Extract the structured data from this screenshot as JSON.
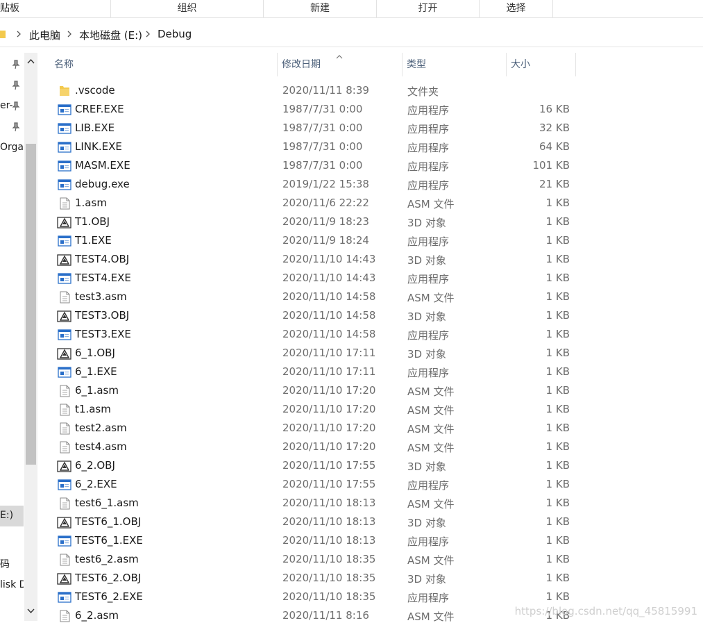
{
  "ribbon": {
    "groups": [
      "贴板",
      "组织",
      "新建",
      "打开",
      "选择"
    ]
  },
  "address": {
    "crumbs": [
      "此电脑",
      "本地磁盘 (E:)",
      "Debug"
    ]
  },
  "nav": {
    "items": [
      "",
      "",
      "er-",
      "",
      "Orga",
      "E:)",
      "",
      "码",
      "lisk D"
    ]
  },
  "columns": {
    "name": "名称",
    "date": "修改日期",
    "type": "类型",
    "size": "大小"
  },
  "files": [
    {
      "name": ".vscode",
      "date": "2020/11/11 8:39",
      "type": "文件夹",
      "size": "",
      "icon": "folder-icon"
    },
    {
      "name": "CREF.EXE",
      "date": "1987/7/31 0:00",
      "type": "应用程序",
      "size": "16 KB",
      "icon": "exe-icon"
    },
    {
      "name": "LIB.EXE",
      "date": "1987/7/31 0:00",
      "type": "应用程序",
      "size": "32 KB",
      "icon": "exe-icon"
    },
    {
      "name": "LINK.EXE",
      "date": "1987/7/31 0:00",
      "type": "应用程序",
      "size": "64 KB",
      "icon": "exe-icon"
    },
    {
      "name": "MASM.EXE",
      "date": "1987/7/31 0:00",
      "type": "应用程序",
      "size": "101 KB",
      "icon": "exe-icon"
    },
    {
      "name": "debug.exe",
      "date": "2019/1/22 15:38",
      "type": "应用程序",
      "size": "21 KB",
      "icon": "exe-icon"
    },
    {
      "name": "1.asm",
      "date": "2020/11/6 22:22",
      "type": "ASM 文件",
      "size": "1 KB",
      "icon": "text-file-icon"
    },
    {
      "name": "T1.OBJ",
      "date": "2020/11/9 18:23",
      "type": "3D 对象",
      "size": "1 KB",
      "icon": "obj-icon"
    },
    {
      "name": "T1.EXE",
      "date": "2020/11/9 18:24",
      "type": "应用程序",
      "size": "1 KB",
      "icon": "exe-icon"
    },
    {
      "name": "TEST4.OBJ",
      "date": "2020/11/10 14:43",
      "type": "3D 对象",
      "size": "1 KB",
      "icon": "obj-icon"
    },
    {
      "name": "TEST4.EXE",
      "date": "2020/11/10 14:43",
      "type": "应用程序",
      "size": "1 KB",
      "icon": "exe-icon"
    },
    {
      "name": "test3.asm",
      "date": "2020/11/10 14:58",
      "type": "ASM 文件",
      "size": "1 KB",
      "icon": "text-file-icon"
    },
    {
      "name": "TEST3.OBJ",
      "date": "2020/11/10 14:58",
      "type": "3D 对象",
      "size": "1 KB",
      "icon": "obj-icon"
    },
    {
      "name": "TEST3.EXE",
      "date": "2020/11/10 14:58",
      "type": "应用程序",
      "size": "1 KB",
      "icon": "exe-icon"
    },
    {
      "name": "6_1.OBJ",
      "date": "2020/11/10 17:11",
      "type": "3D 对象",
      "size": "1 KB",
      "icon": "obj-icon"
    },
    {
      "name": "6_1.EXE",
      "date": "2020/11/10 17:11",
      "type": "应用程序",
      "size": "1 KB",
      "icon": "exe-icon"
    },
    {
      "name": "6_1.asm",
      "date": "2020/11/10 17:20",
      "type": "ASM 文件",
      "size": "1 KB",
      "icon": "text-file-icon"
    },
    {
      "name": "t1.asm",
      "date": "2020/11/10 17:20",
      "type": "ASM 文件",
      "size": "1 KB",
      "icon": "text-file-icon"
    },
    {
      "name": "test2.asm",
      "date": "2020/11/10 17:20",
      "type": "ASM 文件",
      "size": "1 KB",
      "icon": "text-file-icon"
    },
    {
      "name": "test4.asm",
      "date": "2020/11/10 17:20",
      "type": "ASM 文件",
      "size": "1 KB",
      "icon": "text-file-icon"
    },
    {
      "name": "6_2.OBJ",
      "date": "2020/11/10 17:55",
      "type": "3D 对象",
      "size": "1 KB",
      "icon": "obj-icon"
    },
    {
      "name": "6_2.EXE",
      "date": "2020/11/10 17:55",
      "type": "应用程序",
      "size": "1 KB",
      "icon": "exe-icon"
    },
    {
      "name": "test6_1.asm",
      "date": "2020/11/10 18:13",
      "type": "ASM 文件",
      "size": "1 KB",
      "icon": "text-file-icon"
    },
    {
      "name": "TEST6_1.OBJ",
      "date": "2020/11/10 18:13",
      "type": "3D 对象",
      "size": "1 KB",
      "icon": "obj-icon"
    },
    {
      "name": "TEST6_1.EXE",
      "date": "2020/11/10 18:13",
      "type": "应用程序",
      "size": "1 KB",
      "icon": "exe-icon"
    },
    {
      "name": "test6_2.asm",
      "date": "2020/11/10 18:35",
      "type": "ASM 文件",
      "size": "1 KB",
      "icon": "text-file-icon"
    },
    {
      "name": "TEST6_2.OBJ",
      "date": "2020/11/10 18:35",
      "type": "3D 对象",
      "size": "1 KB",
      "icon": "obj-icon"
    },
    {
      "name": "TEST6_2.EXE",
      "date": "2020/11/10 18:35",
      "type": "应用程序",
      "size": "1 KB",
      "icon": "exe-icon"
    },
    {
      "name": "6_2.asm",
      "date": "2020/11/11 8:16",
      "type": "ASM 文件",
      "size": "1 KB",
      "icon": "text-file-icon"
    }
  ],
  "watermark": "https://blog.csdn.net/qq_45815991",
  "colors": {
    "header_text": "#4c607a",
    "secondary_text": "#6d6d6d",
    "folder_yellow": "#f3c94d",
    "exe_blue": "#2a6fc9"
  }
}
